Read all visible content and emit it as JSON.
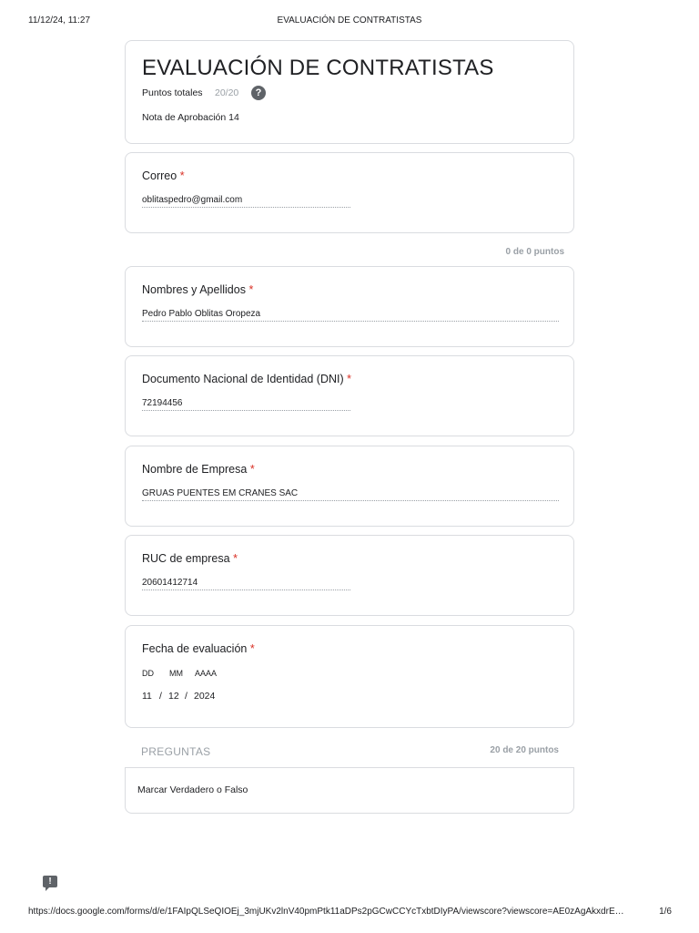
{
  "print_header": {
    "datetime": "11/12/24, 11:27",
    "title": "EVALUACIÓN DE CONTRATISTAS"
  },
  "form_header": {
    "title": "EVALUACIÓN DE CONTRATISTAS",
    "points_label": "Puntos totales",
    "points_value": "20/20",
    "help_icon": "?",
    "passing_grade": "Nota de Aprobación 14"
  },
  "required_marker": "*",
  "questions": {
    "correo": {
      "label": "Correo",
      "answer": "oblitaspedro@gmail.com"
    },
    "section_points": "0 de 0 puntos",
    "nombres": {
      "label": "Nombres y Apellidos",
      "answer": "Pedro Pablo Oblitas Oropeza"
    },
    "dni": {
      "label": "Documento Nacional de Identidad (DNI)",
      "answer": "72194456"
    },
    "empresa": {
      "label": "Nombre de Empresa",
      "answer": "GRUAS PUENTES EM CRANES SAC"
    },
    "ruc": {
      "label": "RUC de empresa",
      "answer": "20601412714"
    },
    "fecha": {
      "label": "Fecha de evaluación",
      "day_label": "DD",
      "month_label": "MM",
      "year_label": "AAAA",
      "day": "11",
      "separator": "/",
      "month": "12",
      "year": "2024"
    }
  },
  "preguntas_section": {
    "title": "PREGUNTAS",
    "points": "20 de 20 puntos"
  },
  "instruction": "Marcar Verdadero o Falso",
  "icons": {
    "help": "help-icon",
    "feedback": "feedback-icon"
  },
  "print_footer": {
    "url": "https://docs.google.com/forms/d/e/1FAIpQLSeQIOEj_3mjUKv2lnV40pmPtk11aDPs2pGCwCCYcTxbtDIyPA/viewscore?viewscore=AE0zAgAkxdrE…",
    "page": "1/6"
  }
}
